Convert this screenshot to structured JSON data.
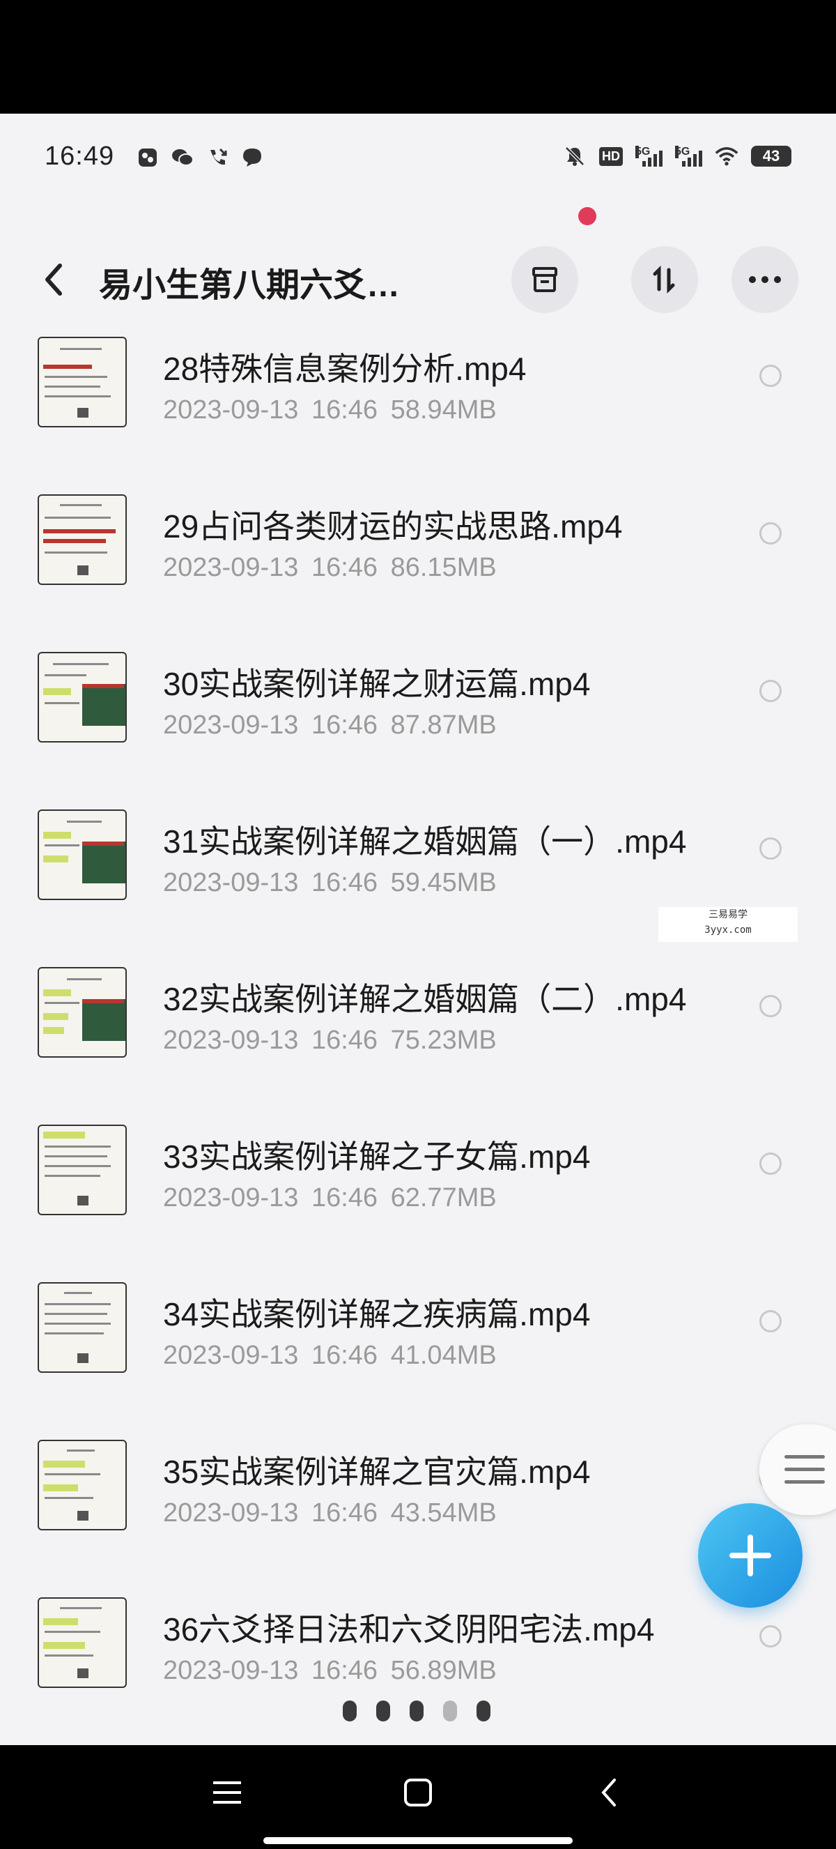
{
  "status_bar": {
    "time": "16:49",
    "hd_label": "HD",
    "network_1": "5G",
    "network_2": "5G",
    "battery": "43"
  },
  "header": {
    "title": "易小生第八期六爻…",
    "icons": [
      "archive-icon",
      "sort-icon",
      "more-icon"
    ]
  },
  "files": [
    {
      "name": "28特殊信息案例分析.mp4",
      "date": "2023-09-13",
      "time": "16:46",
      "size": "58.94MB"
    },
    {
      "name": "29占问各类财运的实战思路.mp4",
      "date": "2023-09-13",
      "time": "16:46",
      "size": "86.15MB"
    },
    {
      "name": "30实战案例详解之财运篇.mp4",
      "date": "2023-09-13",
      "time": "16:46",
      "size": "87.87MB"
    },
    {
      "name": "31实战案例详解之婚姻篇（一）.mp4",
      "date": "2023-09-13",
      "time": "16:46",
      "size": "59.45MB"
    },
    {
      "name": "32实战案例详解之婚姻篇（二）.mp4",
      "date": "2023-09-13",
      "time": "16:46",
      "size": "75.23MB"
    },
    {
      "name": "33实战案例详解之子女篇.mp4",
      "date": "2023-09-13",
      "time": "16:46",
      "size": "62.77MB"
    },
    {
      "name": "34实战案例详解之疾病篇.mp4",
      "date": "2023-09-13",
      "time": "16:46",
      "size": "41.04MB"
    },
    {
      "name": "35实战案例详解之官灾篇.mp4",
      "date": "2023-09-13",
      "time": "16:46",
      "size": "43.54MB"
    },
    {
      "name": "36六爻择日法和六爻阴阳宅法.mp4",
      "date": "2023-09-13",
      "time": "16:46",
      "size": "56.89MB"
    }
  ],
  "watermark": {
    "line1": "三易易学",
    "line2": "3yyx.com"
  },
  "pager": {
    "count": 5,
    "active_index": 3
  },
  "colors": {
    "accent": "#1a8ddf",
    "notification_dot": "#e13b5c",
    "background": "#f3f3f5"
  }
}
